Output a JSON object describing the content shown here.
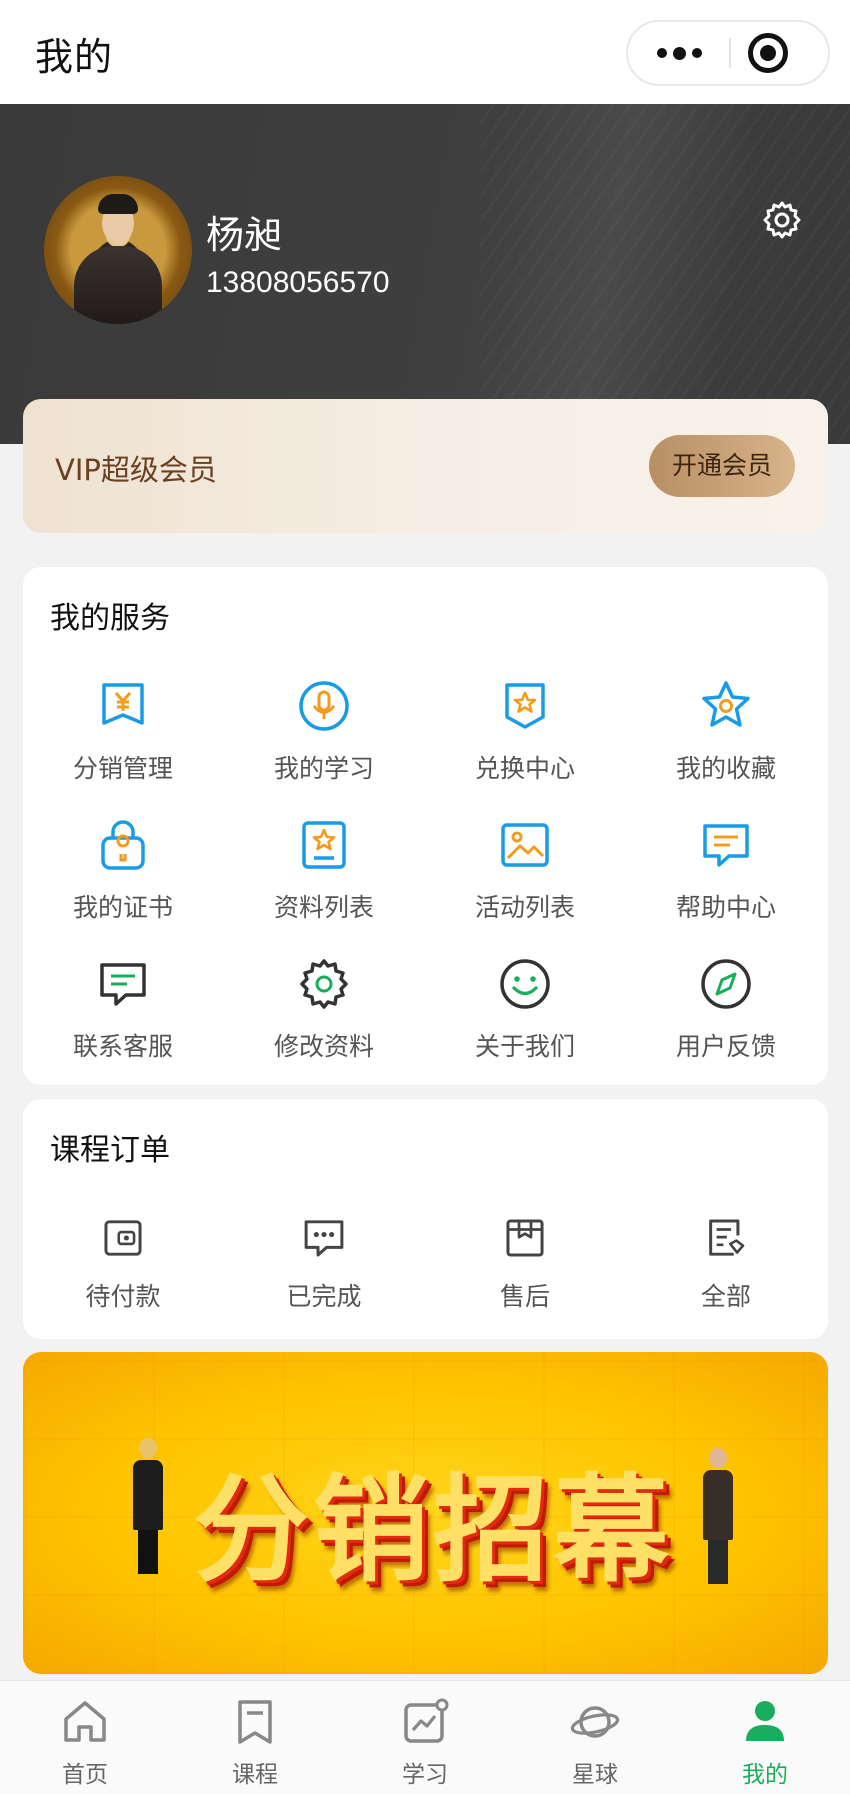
{
  "navbar": {
    "title": "我的"
  },
  "profile": {
    "name": "杨昶",
    "phone": "13808056570"
  },
  "vip": {
    "label": "VIP超级会员",
    "button": "开通会员"
  },
  "services": {
    "title": "我的服务",
    "items": [
      {
        "label": "分销管理",
        "icon": "yen-bookmark-icon"
      },
      {
        "label": "我的学习",
        "icon": "microphone-icon"
      },
      {
        "label": "兑换中心",
        "icon": "star-badge-icon"
      },
      {
        "label": "我的收藏",
        "icon": "star-icon"
      },
      {
        "label": "我的证书",
        "icon": "certificate-lock-icon"
      },
      {
        "label": "资料列表",
        "icon": "star-document-icon"
      },
      {
        "label": "活动列表",
        "icon": "image-icon"
      },
      {
        "label": "帮助中心",
        "icon": "message-icon"
      },
      {
        "label": "联系客服",
        "icon": "chat-icon"
      },
      {
        "label": "修改资料",
        "icon": "gear-icon"
      },
      {
        "label": "关于我们",
        "icon": "smile-icon"
      },
      {
        "label": "用户反馈",
        "icon": "compass-icon"
      }
    ]
  },
  "orders": {
    "title": "课程订单",
    "items": [
      {
        "label": "待付款",
        "icon": "wallet-icon"
      },
      {
        "label": "已完成",
        "icon": "chat-dots-icon"
      },
      {
        "label": "售后",
        "icon": "box-icon"
      },
      {
        "label": "全部",
        "icon": "list-icon"
      }
    ]
  },
  "banner": {
    "text": "分销招幕"
  },
  "tabbar": {
    "items": [
      {
        "label": "首页",
        "icon": "home-icon"
      },
      {
        "label": "课程",
        "icon": "bookmark-icon"
      },
      {
        "label": "学习",
        "icon": "chart-icon"
      },
      {
        "label": "星球",
        "icon": "planet-icon"
      },
      {
        "label": "我的",
        "icon": "user-icon"
      }
    ],
    "active_index": 4,
    "active_color": "#1aad5e"
  },
  "colors": {
    "accent_blue": "#1a9be6",
    "accent_orange": "#f29b1d",
    "accent_green": "#1aad5e",
    "header_dark": "#3a3a3a"
  }
}
